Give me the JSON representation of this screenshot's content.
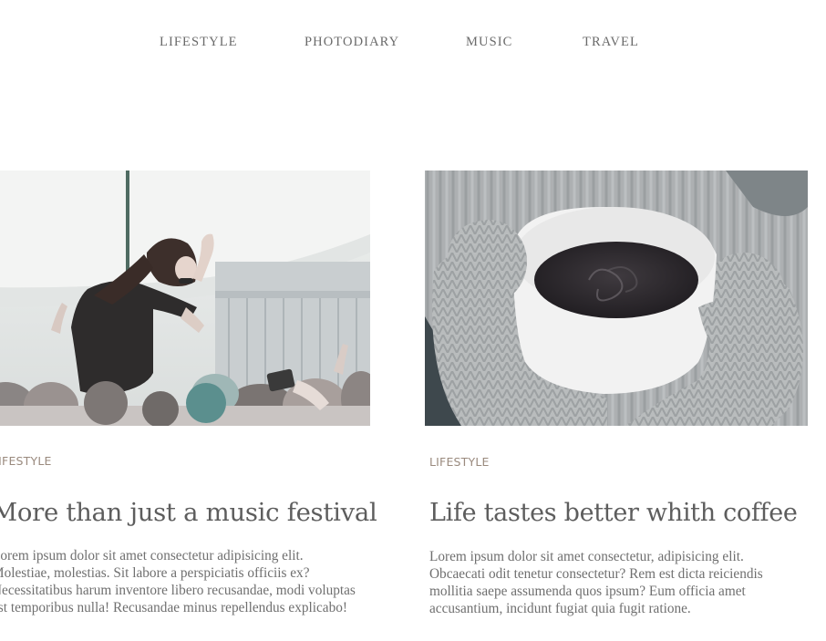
{
  "nav": {
    "items": [
      {
        "label": "LIFESTYLE"
      },
      {
        "label": "PHOTODIARY"
      },
      {
        "label": "MUSIC"
      },
      {
        "label": "TRAVEL"
      }
    ]
  },
  "posts": [
    {
      "image_alt": "festival-crowd-photo",
      "category": "LIFESTYLE",
      "title": "More than just a music festival",
      "excerpt_lines": [
        "Lorem ipsum dolor sit amet consectetur adipisicing elit.",
        "Molestiae, molestias. Sit labore a perspiciatis officiis ex?",
        "Necessitatibus harum inventore libero recusandae, modi voluptas",
        "est temporibus nulla! Recusandae minus repellendus explicabo!"
      ]
    },
    {
      "image_alt": "coffee-in-mittens-photo",
      "category": "LIFESTYLE",
      "title": "Life tastes better whith coffee",
      "excerpt_lines": [
        "Lorem ipsum dolor sit amet consectetur, adipisicing elit.",
        "Obcaecati odit tenetur consectetur? Rem est dicta reiciendis",
        "mollitia saepe assumenda quos ipsum? Eum officia amet",
        "accusantium, incidunt fugiat quia fugit ratione."
      ]
    }
  ]
}
